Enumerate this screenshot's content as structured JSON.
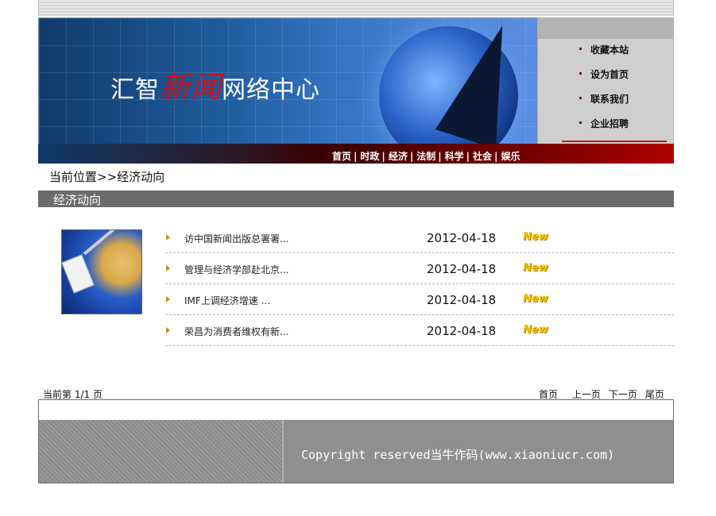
{
  "header": {
    "logo_part1": "汇智",
    "logo_part2": "新闻",
    "logo_part3": "网络中心"
  },
  "side_menu": {
    "items": [
      "收藏本站",
      "设为首页",
      "联系我们",
      "企业招聘"
    ]
  },
  "nav": {
    "items": [
      "首页",
      "时政",
      "经济",
      "法制",
      "科学",
      "社会",
      "娱乐"
    ],
    "separator": "|"
  },
  "breadcrumb": "当前位置>>经济动向",
  "section_title": "经济动向",
  "news": [
    {
      "title": "访中国新闻出版总署署...",
      "date": "2012-04-18",
      "badge": "New"
    },
    {
      "title": "管理与经济学部赴北京...",
      "date": "2012-04-18",
      "badge": "New"
    },
    {
      "title": "IMF上调经济增速 ...",
      "date": "2012-04-18",
      "badge": "New"
    },
    {
      "title": "荣昌为消费者维权有新...",
      "date": "2012-04-18",
      "badge": "New"
    }
  ],
  "pager": {
    "current": "当前第 1/1 页",
    "first": "首页",
    "prev": "上一页",
    "next": "下一页",
    "last": "尾页"
  },
  "footer": {
    "copyright": "Copyright reserved当牛作码(www.xiaoniucr.com)"
  }
}
